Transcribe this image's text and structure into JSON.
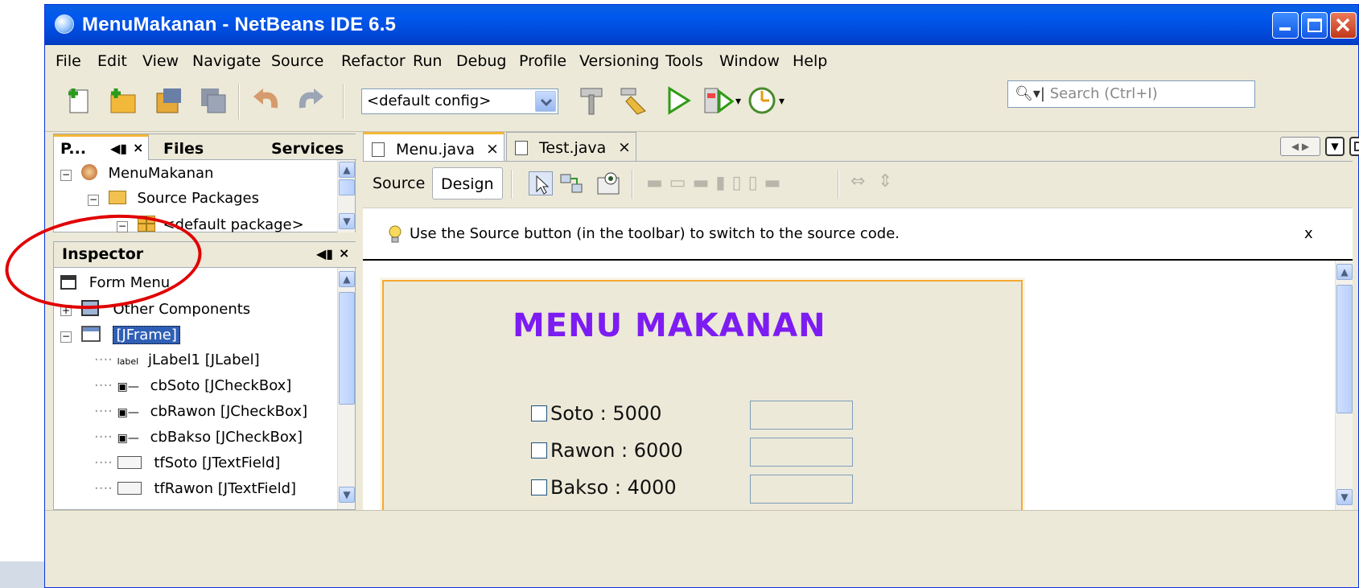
{
  "window": {
    "title": "MenuMakanan - NetBeans IDE 6.5"
  },
  "menu": [
    "File",
    "Edit",
    "View",
    "Navigate",
    "Source",
    "Refactor",
    "Run",
    "Debug",
    "Profile",
    "Versioning",
    "Tools",
    "Window",
    "Help"
  ],
  "toolbar": {
    "config_value": "<default config>",
    "search_placeholder": "Search (Ctrl+I)"
  },
  "projects_panel": {
    "tabs": [
      "P...",
      "Files",
      "Services"
    ],
    "close_glyph": "×",
    "items": [
      {
        "label": "MenuMakanan",
        "icon": "project-icon"
      },
      {
        "label": "Source Packages",
        "icon": "folder-icon"
      },
      {
        "label": "<default package>",
        "icon": "package-icon"
      }
    ]
  },
  "inspector": {
    "title": "Inspector",
    "close_glyph": "×",
    "items": [
      {
        "label": "Form Menu",
        "icon": "form-icon"
      },
      {
        "label": "Other Components",
        "icon": "components-icon"
      },
      {
        "label": "[JFrame]",
        "icon": "frame-icon"
      },
      {
        "label": "jLabel1 [JLabel]",
        "icon": "label-icon"
      },
      {
        "label": "cbSoto [JCheckBox]",
        "icon": "checkbox-icon"
      },
      {
        "label": "cbRawon [JCheckBox]",
        "icon": "checkbox-icon"
      },
      {
        "label": "cbBakso [JCheckBox]",
        "icon": "checkbox-icon"
      },
      {
        "label": "tfSoto [JTextField]",
        "icon": "textfield-icon"
      },
      {
        "label": "tfRawon [JTextField]",
        "icon": "textfield-icon"
      }
    ],
    "label_icon_text": "label"
  },
  "editor": {
    "tabs": [
      {
        "label": "Menu.java",
        "active": true
      },
      {
        "label": "Test.java",
        "active": false
      }
    ],
    "close_glyph": "×",
    "source_label": "Source",
    "design_label": "Design",
    "hint": "Use the Source button (in the toolbar) to switch to the source code.",
    "hint_close": "x"
  },
  "form": {
    "title": "MENU MAKANAN",
    "checkboxes": [
      "Soto : 5000",
      "Rawon : 6000",
      "Bakso : 4000"
    ]
  },
  "colors": {
    "form_title": "#7d1cf2",
    "accent_tab": "#f3b634",
    "annotation": "#e00000",
    "titlebar": "#0058ee"
  }
}
